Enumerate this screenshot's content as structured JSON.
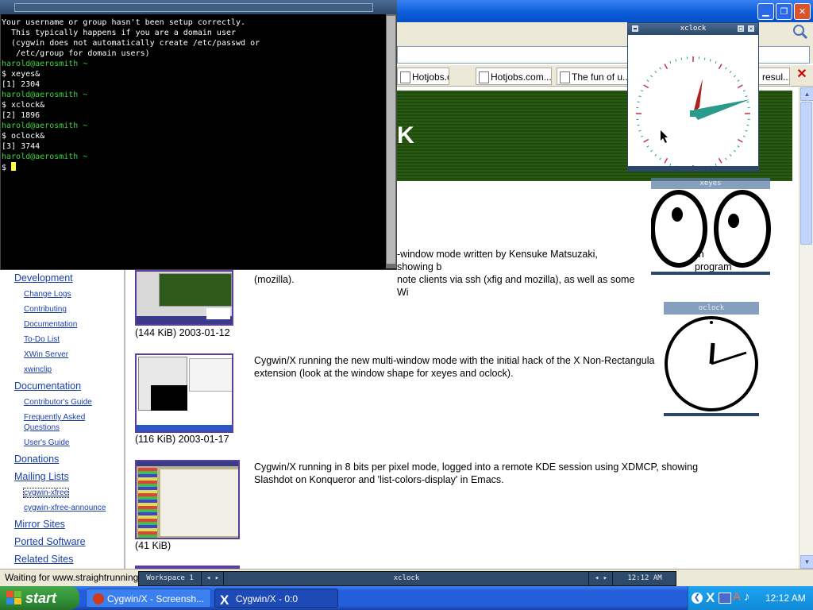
{
  "terminal": {
    "lines": [
      {
        "text": "Your username or group hasn't been setup correctly.",
        "cls": "tw"
      },
      {
        "text": "  This typically happens if you are a domain user",
        "cls": "tw"
      },
      {
        "text": "  (cygwin does not automatically create /etc/passwd or",
        "cls": "tw"
      },
      {
        "text": "   /etc/group for domain users)",
        "cls": "tw"
      },
      {
        "text": "",
        "cls": "tw"
      },
      {
        "text": "harold@aerosmith ~",
        "cls": "tg"
      },
      {
        "text": "$ xeyes&",
        "cls": "tw"
      },
      {
        "text": "[1] 2304",
        "cls": "tw"
      },
      {
        "text": "",
        "cls": "tw"
      },
      {
        "text": "harold@aerosmith ~",
        "cls": "tg"
      },
      {
        "text": "$ xclock&",
        "cls": "tw"
      },
      {
        "text": "[2] 1896",
        "cls": "tw"
      },
      {
        "text": "",
        "cls": "tw"
      },
      {
        "text": "harold@aerosmith ~",
        "cls": "tg"
      },
      {
        "text": "$ oclock&",
        "cls": "tw"
      },
      {
        "text": "[3] 3744",
        "cls": "tw"
      },
      {
        "text": "",
        "cls": "tw"
      },
      {
        "text": "harold@aerosmith ~",
        "cls": "tg"
      },
      {
        "text": "$ ",
        "cls": "tw"
      }
    ]
  },
  "browser": {
    "tabs": [
      "Hotjobs.com...",
      "Hotjobs.com...",
      "The fun of u...",
      "resul..."
    ],
    "tab_close": "✕",
    "banner_fragment": "K"
  },
  "sidebar": {
    "items": [
      {
        "label": "Development",
        "level": 1
      },
      {
        "label": "Change Logs",
        "level": 2
      },
      {
        "label": "Contributing",
        "level": 2
      },
      {
        "label": "Documentation",
        "level": 2
      },
      {
        "label": "To-Do List",
        "level": 2
      },
      {
        "label": "XWin Server",
        "level": 2
      },
      {
        "label": "xwinclip",
        "level": 2
      },
      {
        "label": "Documentation",
        "level": 1
      },
      {
        "label": "Contributor's Guide",
        "level": 2
      },
      {
        "label": "Frequently Asked",
        "level": 2
      },
      {
        "label": "Questions",
        "level": 2
      },
      {
        "label": "User's Guide",
        "level": 2
      },
      {
        "label": "Donations",
        "level": 1
      },
      {
        "label": "Mailing Lists",
        "level": 1
      },
      {
        "label": "cygwin-xfree",
        "level": 2
      },
      {
        "label": "cygwin-xfree-announce",
        "level": 2
      },
      {
        "label": "Mirror Sites",
        "level": 1
      },
      {
        "label": "Ported Software",
        "level": 1
      },
      {
        "label": "Related Sites",
        "level": 1
      }
    ]
  },
  "content": {
    "entries": [
      {
        "desc_lines": [
          "-window mode written by Kensuke Matsuzaki, showing b",
          "note clients via ssh (xfig and mozilla), as well as some Wi",
          "(mozilla)."
        ],
        "caption": "(144 KiB) 2003-01-12"
      },
      {
        "desc_lines": [
          "Cygwin/X running the new multi-window mode with the initial hack of the X Non-Rectangula",
          "extension (look at the window shape for xeyes and oclock)."
        ],
        "caption": "(116 KiB) 2003-01-17"
      },
      {
        "desc_lines": [
          "Cygwin/X running in 8 bits per pixel mode, logged into a remote KDE session using XDMCP, showing",
          "Slashdot on Konqueror and 'list-colors-display' in Emacs."
        ],
        "caption": "(41 KiB)"
      }
    ],
    "desc1_tail_a": "ien",
    "desc1_tail_b": "program"
  },
  "xclock": {
    "title": "xclock"
  },
  "xeyes": {
    "title": "xeyes"
  },
  "oclock": {
    "title": "oclock"
  },
  "status": {
    "text": "Waiting for www.straightrunning.com..."
  },
  "xpanel": {
    "workspace": "Workspace 1",
    "arrows_left": "◂  ▸",
    "window": "xclock",
    "arrows_right": "◂  ▸",
    "time": "12:12 AM"
  },
  "taskbar": {
    "start": "start",
    "tasks": [
      {
        "label": "Cygwin/X - Screensh...",
        "active": false
      },
      {
        "label": "Cygwin/X - 0:0",
        "active": true
      }
    ],
    "clock": "12:12 AM"
  },
  "colors": {
    "xp_blue": "#245edb",
    "start_green": "#318f36",
    "terminal_green": "#3fd43f"
  }
}
